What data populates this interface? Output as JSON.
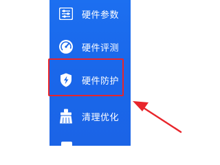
{
  "sidebar": {
    "items": [
      {
        "label": "硬件参数",
        "icon": "sliders-icon"
      },
      {
        "label": "硬件评测",
        "icon": "speedometer-icon"
      },
      {
        "label": "硬件防护",
        "icon": "shield-lightning-icon"
      },
      {
        "label": "清理优化",
        "icon": "broom-icon"
      }
    ]
  },
  "colors": {
    "sidebar_bg": "#1a67ea",
    "highlight": "#e8252b",
    "text": "#ffffff"
  }
}
